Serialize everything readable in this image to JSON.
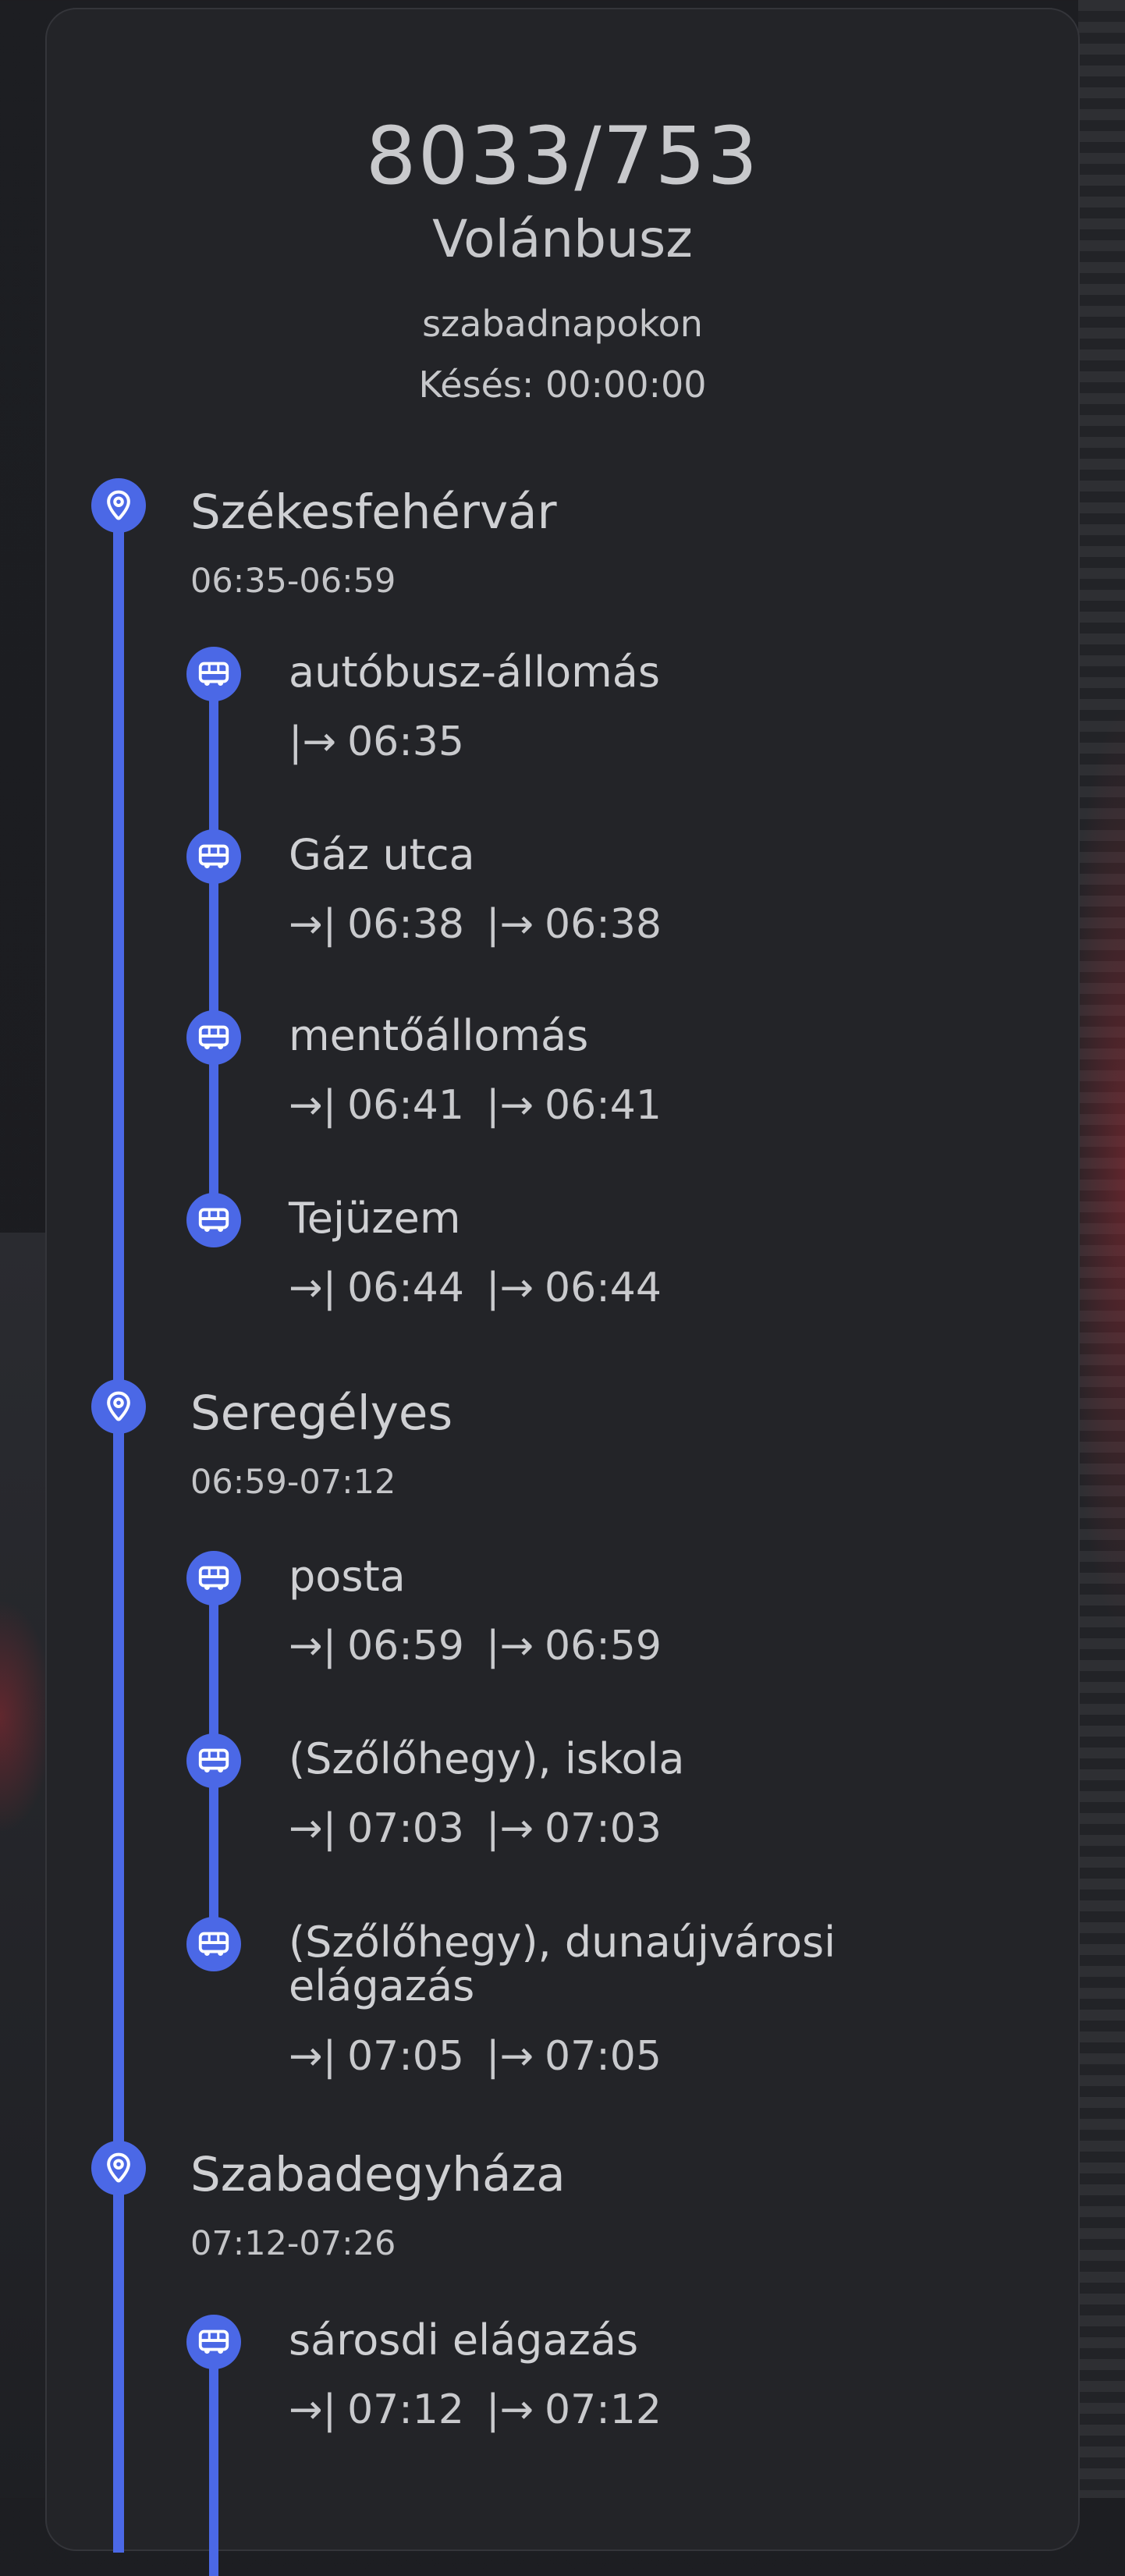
{
  "header": {
    "route": "8033/753",
    "operator": "Volánbusz",
    "days": "szabadnapokon",
    "delay": "Késés: 00:00:00"
  },
  "icons": {
    "town": "map-pin-icon",
    "stop": "bus-icon",
    "accent_color": "#4b68e6"
  },
  "groups": [
    {
      "city": "Székesfehérvár",
      "range": "06:35-06:59",
      "stops": [
        {
          "name": "autóbusz-állomás",
          "dep_symbol": "|→",
          "dep": "06:35"
        },
        {
          "name": "Gáz utca",
          "arr_symbol": "→|",
          "arr": "06:38",
          "dep_symbol": "|→",
          "dep": "06:38"
        },
        {
          "name": "mentőállomás",
          "arr_symbol": "→|",
          "arr": "06:41",
          "dep_symbol": "|→",
          "dep": "06:41"
        },
        {
          "name": "Tejüzem",
          "arr_symbol": "→|",
          "arr": "06:44",
          "dep_symbol": "|→",
          "dep": "06:44"
        }
      ]
    },
    {
      "city": "Seregélyes",
      "range": "06:59-07:12",
      "stops": [
        {
          "name": "posta",
          "arr_symbol": "→|",
          "arr": "06:59",
          "dep_symbol": "|→",
          "dep": "06:59"
        },
        {
          "name": "(Szőlőhegy), iskola",
          "arr_symbol": "→|",
          "arr": "07:03",
          "dep_symbol": "|→",
          "dep": "07:03"
        },
        {
          "name": "(Szőlőhegy), dunaújvárosi elágazás",
          "arr_symbol": "→|",
          "arr": "07:05",
          "dep_symbol": "|→",
          "dep": "07:05"
        }
      ]
    },
    {
      "city": "Szabadegyháza",
      "range": "07:12-07:26",
      "stops": [
        {
          "name": "sárosdi elágazás",
          "arr_symbol": "→|",
          "arr": "07:12",
          "dep_symbol": "|→",
          "dep": "07:12"
        }
      ]
    }
  ]
}
